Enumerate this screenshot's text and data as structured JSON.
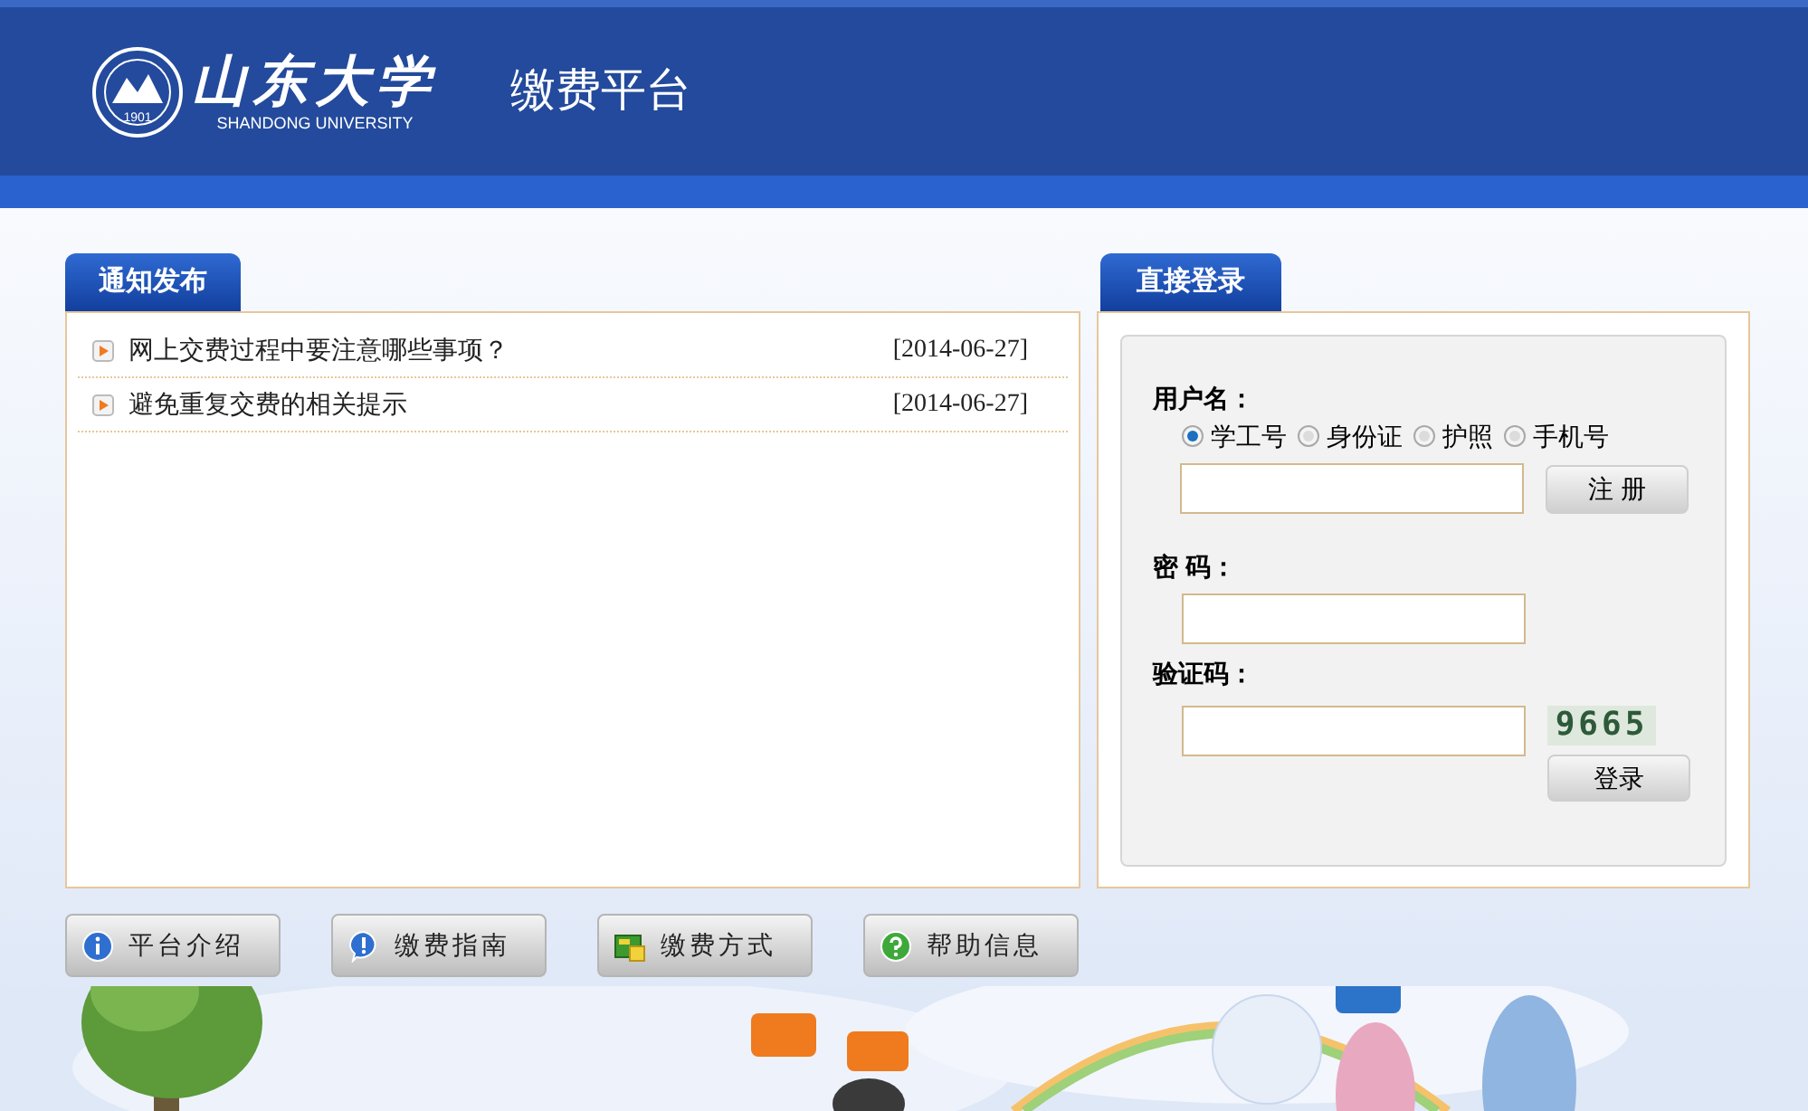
{
  "header": {
    "logo_text": "山东大学",
    "logo_subtitle": "SHANDONG UNIVERSITY",
    "seal_year": "1901",
    "title": "缴费平台"
  },
  "notices": {
    "tab": "通知发布",
    "items": [
      {
        "title": "网上交费过程中要注意哪些事项？",
        "date": "[2014-06-27]"
      },
      {
        "title": "避免重复交费的相关提示",
        "date": "[2014-06-27]"
      }
    ]
  },
  "login": {
    "tab": "直接登录",
    "username_label": "用户名：",
    "id_types": [
      {
        "label": "学工号",
        "selected": true
      },
      {
        "label": "身份证",
        "selected": false
      },
      {
        "label": "护照",
        "selected": false
      },
      {
        "label": "手机号",
        "selected": false
      }
    ],
    "register_button": "注 册",
    "password_label": "密 码：",
    "captcha_label": "验证码：",
    "captcha": "9665",
    "login_button": "登录"
  },
  "nav_buttons": [
    {
      "label": "平台介绍",
      "kind": "info"
    },
    {
      "label": "缴费指南",
      "kind": "notice"
    },
    {
      "label": "缴费方式",
      "kind": "money"
    },
    {
      "label": "帮助信息",
      "kind": "help"
    }
  ]
}
